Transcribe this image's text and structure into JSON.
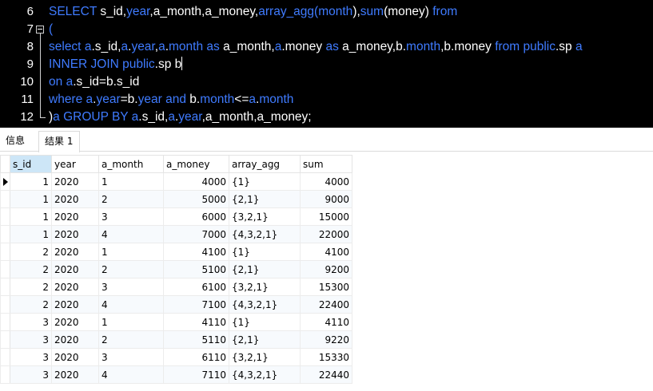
{
  "editor": {
    "lines": [
      {
        "num": "6",
        "tokens": [
          {
            "t": "SELECT ",
            "c": "kw"
          },
          {
            "t": "s_id,",
            "c": ""
          },
          {
            "t": "year",
            "c": "fn"
          },
          {
            "t": ",a_month,a_money,",
            "c": ""
          },
          {
            "t": "array_agg",
            "c": "fn"
          },
          {
            "t": "(",
            "c": "kw"
          },
          {
            "t": "month",
            "c": "fn"
          },
          {
            "t": "),",
            "c": ""
          },
          {
            "t": "sum",
            "c": "fn"
          },
          {
            "t": "(money) ",
            "c": ""
          },
          {
            "t": "from",
            "c": "kw"
          }
        ]
      },
      {
        "num": "7",
        "tokens": [
          {
            "t": "(",
            "c": "kw"
          }
        ]
      },
      {
        "num": "8",
        "tokens": [
          {
            "t": "select ",
            "c": "kw"
          },
          {
            "t": "a",
            "c": "kw"
          },
          {
            "t": ".s_id,",
            "c": ""
          },
          {
            "t": "a",
            "c": "kw"
          },
          {
            "t": ".",
            "c": ""
          },
          {
            "t": "year",
            "c": "fn"
          },
          {
            "t": ",",
            "c": ""
          },
          {
            "t": "a",
            "c": "kw"
          },
          {
            "t": ".",
            "c": ""
          },
          {
            "t": "month",
            "c": "fn"
          },
          {
            "t": " as ",
            "c": "kw"
          },
          {
            "t": "a_month,",
            "c": ""
          },
          {
            "t": "a",
            "c": "kw"
          },
          {
            "t": ".money ",
            "c": ""
          },
          {
            "t": "as ",
            "c": "kw"
          },
          {
            "t": "a_money,b.",
            "c": ""
          },
          {
            "t": "month",
            "c": "fn"
          },
          {
            "t": ",b.money ",
            "c": ""
          },
          {
            "t": "from ",
            "c": "kw"
          },
          {
            "t": "public",
            "c": "kw"
          },
          {
            "t": ".sp ",
            "c": ""
          },
          {
            "t": "a",
            "c": "kw"
          }
        ]
      },
      {
        "num": "9",
        "tokens": [
          {
            "t": "INNER JOIN ",
            "c": "kw"
          },
          {
            "t": "public",
            "c": "kw"
          },
          {
            "t": ".sp b",
            "c": ""
          }
        ],
        "caret": true
      },
      {
        "num": "10",
        "tokens": [
          {
            "t": "on ",
            "c": "kw"
          },
          {
            "t": "a",
            "c": "kw"
          },
          {
            "t": ".s_id=b.s_id",
            "c": ""
          }
        ]
      },
      {
        "num": "11",
        "tokens": [
          {
            "t": "where ",
            "c": "kw"
          },
          {
            "t": "a",
            "c": "kw"
          },
          {
            "t": ".",
            "c": ""
          },
          {
            "t": "year",
            "c": "fn"
          },
          {
            "t": "=b.",
            "c": ""
          },
          {
            "t": "year",
            "c": "fn"
          },
          {
            "t": " and ",
            "c": "kw"
          },
          {
            "t": "b.",
            "c": ""
          },
          {
            "t": "month",
            "c": "fn"
          },
          {
            "t": "<=",
            "c": ""
          },
          {
            "t": "a",
            "c": "kw"
          },
          {
            "t": ".",
            "c": ""
          },
          {
            "t": "month",
            "c": "fn"
          }
        ]
      },
      {
        "num": "12",
        "tokens": [
          {
            "t": ")",
            "c": ""
          },
          {
            "t": "a GROUP BY ",
            "c": "kw"
          },
          {
            "t": "a",
            "c": "kw"
          },
          {
            "t": ".s_id,",
            "c": ""
          },
          {
            "t": "a",
            "c": "kw"
          },
          {
            "t": ".",
            "c": ""
          },
          {
            "t": "year",
            "c": "fn"
          },
          {
            "t": ",a_month,a_money;",
            "c": ""
          }
        ]
      }
    ]
  },
  "tabs": {
    "info": "信息",
    "result": "结果 1"
  },
  "grid": {
    "columns": [
      "s_id",
      "year",
      "a_month",
      "a_money",
      "array_agg",
      "sum"
    ],
    "rows": [
      [
        "1",
        "2020",
        "1",
        "4000",
        "{1}",
        "4000"
      ],
      [
        "1",
        "2020",
        "2",
        "5000",
        "{2,1}",
        "9000"
      ],
      [
        "1",
        "2020",
        "3",
        "6000",
        "{3,2,1}",
        "15000"
      ],
      [
        "1",
        "2020",
        "4",
        "7000",
        "{4,3,2,1}",
        "22000"
      ],
      [
        "2",
        "2020",
        "1",
        "4100",
        "{1}",
        "4100"
      ],
      [
        "2",
        "2020",
        "2",
        "5100",
        "{2,1}",
        "9200"
      ],
      [
        "2",
        "2020",
        "3",
        "6100",
        "{3,2,1}",
        "15300"
      ],
      [
        "2",
        "2020",
        "4",
        "7100",
        "{4,3,2,1}",
        "22400"
      ],
      [
        "3",
        "2020",
        "1",
        "4110",
        "{1}",
        "4110"
      ],
      [
        "3",
        "2020",
        "2",
        "5110",
        "{2,1}",
        "9220"
      ],
      [
        "3",
        "2020",
        "3",
        "6110",
        "{3,2,1}",
        "15330"
      ],
      [
        "3",
        "2020",
        "4",
        "7110",
        "{4,3,2,1}",
        "22440"
      ]
    ]
  }
}
